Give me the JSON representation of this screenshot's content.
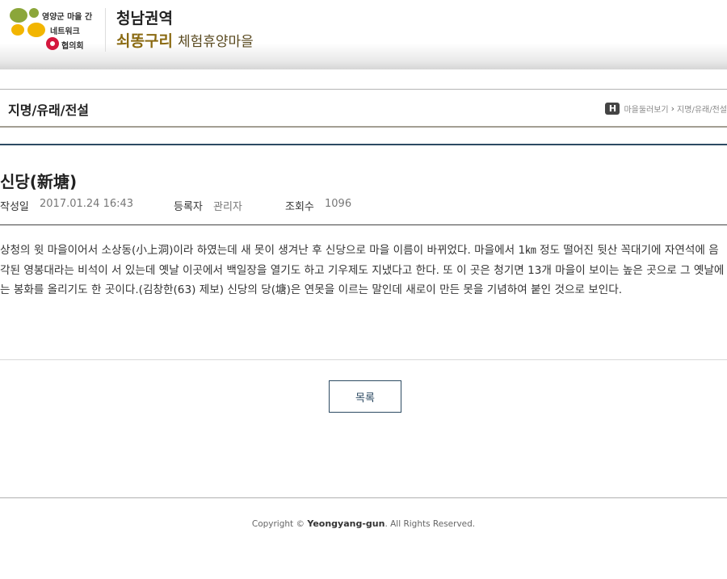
{
  "header": {
    "logo": {
      "line1": "영양군 마을 간",
      "line2": "네트워크",
      "line3": "협의회"
    },
    "site_title": "청남권역",
    "site_subtitle_brand": "쇠똥구리",
    "site_subtitle_rest": "체험휴양마을"
  },
  "page": {
    "title": "지명/유래/전설",
    "breadcrumb": {
      "home_icon_label": "H",
      "separator": "›",
      "items": [
        "마을둘러보기",
        "지명/유래/전설"
      ]
    }
  },
  "article": {
    "title": "신당(新塘)",
    "meta": {
      "date_label": "작성일",
      "date_value": "2017.01.24 16:43",
      "author_label": "등록자",
      "author_value": "관리자",
      "views_label": "조회수",
      "views_value": "1096"
    },
    "body": "상청의 윗 마을이어서 소상동(小上洞)이라 하였는데 새 못이 생겨난 후 신당으로 마을 이름이 바뀌었다. 마을에서 1㎞ 정도 떨어진 뒷산 꼭대기에 자연석에 음각된 영봉대라는 비석이 서 있는데 옛날 이곳에서 백일장을 열기도 하고 기우제도 지냈다고 한다. 또 이 곳은 청기면 13개 마을이 보이는 높은 곳으로 그 옛날에는 봉화를 올리기도 한 곳이다.(김창한(63) 제보) 신당의 당(塘)은 연못을 이르는 말인데 새로이 만든 못을 기념하여 붙인 것으로 보인다."
  },
  "buttons": {
    "list_label": "목록"
  },
  "footer": {
    "copyright_prefix": "Copyright ©",
    "copyright_brand": "Yeongyang-gun",
    "copyright_suffix": ". All Rights Reserved."
  },
  "colors": {
    "accent": "#2d4b63",
    "logo_green": "#8ba63a",
    "logo_yellow": "#f2b500",
    "logo_red": "#d4173d",
    "brand_gold": "#8a6a12"
  }
}
